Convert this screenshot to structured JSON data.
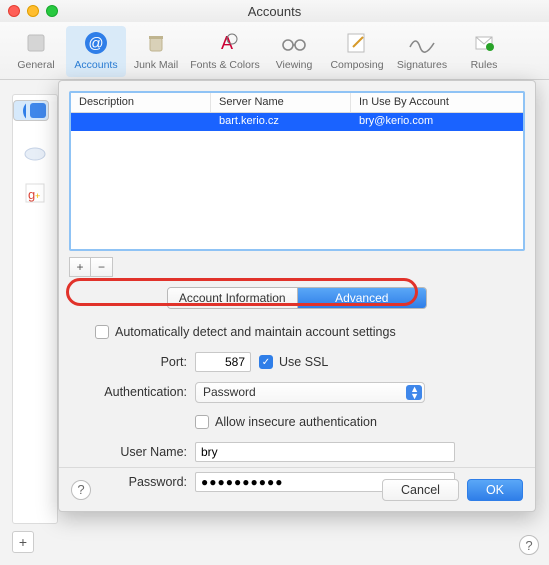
{
  "window": {
    "title": "Accounts"
  },
  "toolbar": {
    "items": [
      {
        "label": "General"
      },
      {
        "label": "Accounts"
      },
      {
        "label": "Junk Mail"
      },
      {
        "label": "Fonts & Colors"
      },
      {
        "label": "Viewing"
      },
      {
        "label": "Composing"
      },
      {
        "label": "Signatures"
      },
      {
        "label": "Rules"
      }
    ]
  },
  "table": {
    "headers": {
      "c1": "Description",
      "c2": "Server Name",
      "c3": "In Use By Account"
    },
    "rows": [
      {
        "description": "",
        "server": "bart.kerio.cz",
        "account": "bry@kerio.com"
      }
    ],
    "add": "+",
    "remove": "−"
  },
  "tabs": {
    "info": "Account Information",
    "advanced": "Advanced"
  },
  "form": {
    "auto_detect_label": "Automatically detect and maintain account settings",
    "port_label": "Port:",
    "port_value": "587",
    "use_ssl_label": "Use SSL",
    "auth_label": "Authentication:",
    "auth_value": "Password",
    "allow_insecure_label": "Allow insecure authentication",
    "user_label": "User Name:",
    "user_value": "bry",
    "password_label": "Password:",
    "password_value": "●●●●●●●●●●"
  },
  "buttons": {
    "cancel": "Cancel",
    "ok": "OK",
    "help": "?"
  },
  "sidebar_add": "+"
}
